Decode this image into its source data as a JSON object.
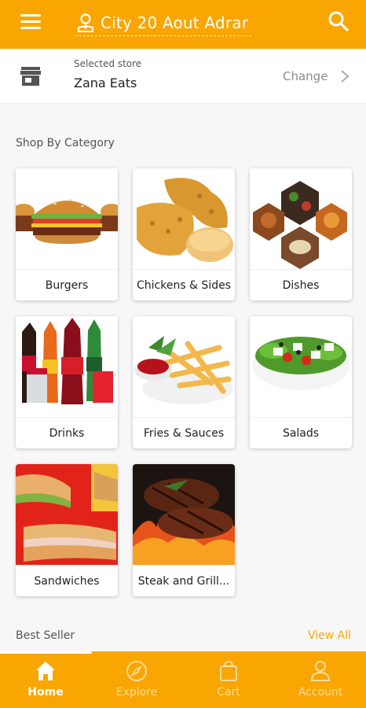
{
  "header": {
    "location_title": "City 20 Aout Adrar",
    "menu_icon": "hamburger-menu-icon",
    "search_icon": "search-icon",
    "background": "#F9A602"
  },
  "store": {
    "caption": "Selected store",
    "name": "Zana Eats",
    "change_label": "Change",
    "icon": "storefront-icon"
  },
  "categories_section": {
    "title": "Shop By Category",
    "items": [
      {
        "label": "Burgers",
        "image": "burger"
      },
      {
        "label": "Chickens & Sides",
        "image": "fried-chicken"
      },
      {
        "label": "Dishes",
        "image": "dishes-collage"
      },
      {
        "label": "Drinks",
        "image": "soda-bottles"
      },
      {
        "label": "Fries & Sauces",
        "image": "fries-ketchup"
      },
      {
        "label": "Salads",
        "image": "greek-salad"
      },
      {
        "label": "Sandwiches",
        "image": "sandwiches"
      },
      {
        "label": "Steak and Grill...",
        "image": "grilled-steak"
      }
    ]
  },
  "best_seller": {
    "title": "Best Seller",
    "view_all": "View All"
  },
  "bottom_nav": {
    "items": [
      {
        "label": "Home",
        "icon": "home-icon",
        "active": true
      },
      {
        "label": "Explore",
        "icon": "compass-icon",
        "active": false
      },
      {
        "label": "Cart",
        "icon": "shopping-bag-icon",
        "active": false
      },
      {
        "label": "Account",
        "icon": "user-icon",
        "active": false
      }
    ]
  },
  "colors": {
    "accent": "#F9A602",
    "background": "#F7F7F7"
  }
}
